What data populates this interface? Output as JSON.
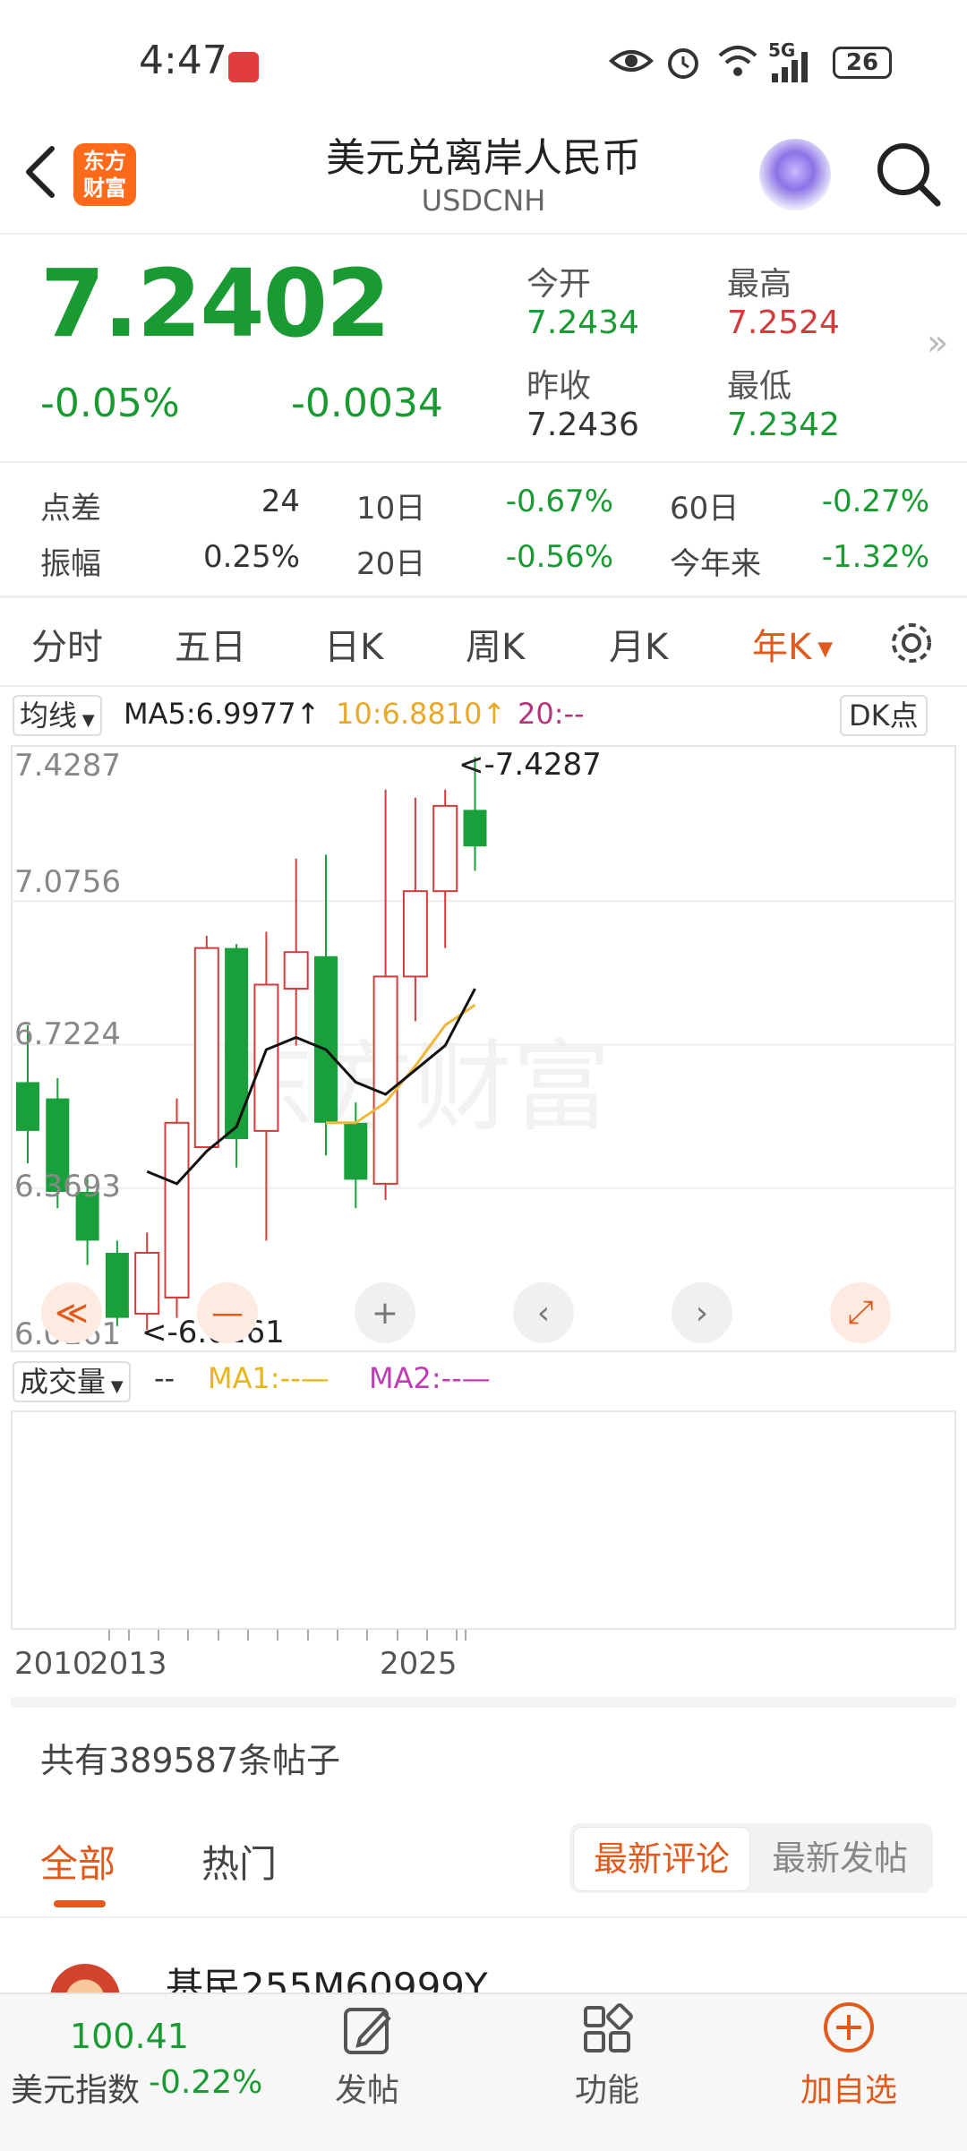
{
  "status_bar": {
    "time": "4:47",
    "network": "5G",
    "battery": "26"
  },
  "header": {
    "title": "美元兑离岸人民币",
    "subtitle": "USDCNH",
    "logo_line1": "东方",
    "logo_line2": "财富"
  },
  "quote": {
    "price": "7.2402",
    "change_pct": "-0.05%",
    "change_val": "-0.0034",
    "open_label": "今开",
    "open": "7.2434",
    "high_label": "最高",
    "high": "7.2524",
    "prev_close_label": "昨收",
    "prev_close": "7.2436",
    "low_label": "最低",
    "low": "7.2342"
  },
  "stats": {
    "spread_label": "点差",
    "spread": "24",
    "d10_label": "10日",
    "d10": "-0.67%",
    "d60_label": "60日",
    "d60": "-0.27%",
    "amp_label": "振幅",
    "amp": "0.25%",
    "d20_label": "20日",
    "d20": "-0.56%",
    "ytd_label": "今年来",
    "ytd": "-1.32%"
  },
  "kline_tabs": [
    "分时",
    "五日",
    "日K",
    "周K",
    "月K",
    "年K"
  ],
  "ma": {
    "selector": "均线",
    "ma5": "MA5:6.9977↑",
    "ma10": "10:6.8810↑",
    "ma20": "20:--",
    "dk": "DK点"
  },
  "chart_data": {
    "type": "candlestick",
    "y_ticks": [
      "7.4287",
      "7.0756",
      "6.7224",
      "6.3693",
      "6.0161"
    ],
    "ylim": [
      6.0161,
      7.4287
    ],
    "max_marker": "<-7.4287",
    "min_marker": "<-6.0161",
    "x_labels": [
      "2010",
      "2013",
      "2025"
    ],
    "candles": [
      {
        "o": 6.63,
        "c": 6.51,
        "h": 6.77,
        "l": 6.43
      },
      {
        "o": 6.59,
        "c": 6.36,
        "h": 6.64,
        "l": 6.32
      },
      {
        "o": 6.36,
        "c": 6.24,
        "h": 6.4,
        "l": 6.18
      },
      {
        "o": 6.21,
        "c": 6.05,
        "h": 6.24,
        "l": 6.03
      },
      {
        "o": 6.06,
        "c": 6.21,
        "h": 6.26,
        "l": 6.02
      },
      {
        "o": 6.1,
        "c": 6.53,
        "h": 6.59,
        "l": 6.05
      },
      {
        "o": 6.47,
        "c": 6.96,
        "h": 6.99,
        "l": 6.47
      },
      {
        "o": 6.96,
        "c": 6.49,
        "h": 6.97,
        "l": 6.42
      },
      {
        "o": 6.51,
        "c": 6.87,
        "h": 7.0,
        "l": 6.24
      },
      {
        "o": 6.86,
        "c": 6.95,
        "h": 7.18,
        "l": 6.72
      },
      {
        "o": 6.94,
        "c": 6.53,
        "h": 7.19,
        "l": 6.45
      },
      {
        "o": 6.53,
        "c": 6.39,
        "h": 6.58,
        "l": 6.32
      },
      {
        "o": 6.38,
        "c": 6.89,
        "h": 7.35,
        "l": 6.34
      },
      {
        "o": 6.89,
        "c": 7.1,
        "h": 7.33,
        "l": 6.78
      },
      {
        "o": 7.1,
        "c": 7.31,
        "h": 7.35,
        "l": 6.96
      },
      {
        "o": 7.3,
        "c": 7.21,
        "h": 7.43,
        "l": 7.15
      }
    ],
    "ma5_line": [
      null,
      null,
      null,
      null,
      6.41,
      6.38,
      6.46,
      6.52,
      6.71,
      6.74,
      6.71,
      6.63,
      6.6,
      6.66,
      6.72,
      6.86
    ],
    "ma10_line": [
      null,
      null,
      null,
      null,
      null,
      null,
      null,
      null,
      null,
      null,
      6.53,
      6.53,
      6.58,
      6.67,
      6.77,
      6.82
    ],
    "controls": [
      "≪",
      "—",
      "+",
      "‹",
      "›",
      "⤢"
    ]
  },
  "volume": {
    "selector": "成交量",
    "dash": "--",
    "ma1": "MA1:--—",
    "ma2": "MA2:--—"
  },
  "posts": {
    "count_text": "共有389587条帖子"
  },
  "comment_tabs": {
    "all": "全部",
    "hot": "热门",
    "latest_comment": "最新评论",
    "latest_post": "最新发帖"
  },
  "first_post": {
    "author": "基民255M60999Y"
  },
  "bottom_nav": {
    "index_value": "100.41",
    "index_label": "美元指数",
    "index_change": "-0.22%",
    "post": "发帖",
    "functions": "功能",
    "add": "加自选"
  },
  "colors": {
    "up": "#d43c3c",
    "down": "#1aa03a",
    "accent": "#e05a1c",
    "ma5": "#111111",
    "ma10": "#f0b93c",
    "ma20": "#b4337a"
  }
}
